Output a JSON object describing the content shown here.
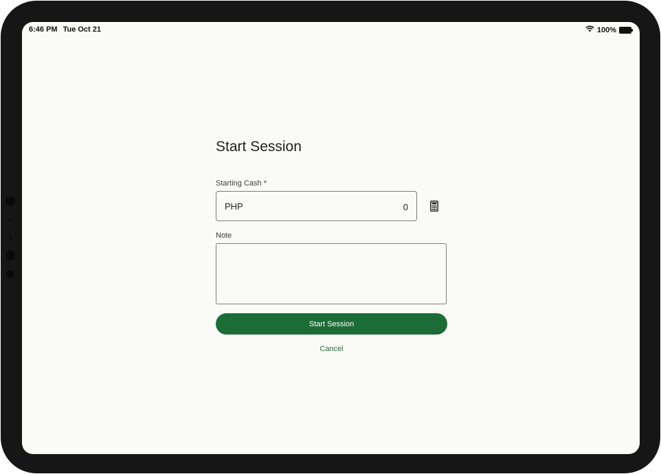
{
  "status_bar": {
    "time": "6:46 PM",
    "date": "Tue Oct 21",
    "battery": "100%",
    "icons": [
      "wifi-icon",
      "battery-icon"
    ]
  },
  "form": {
    "title": "Start Session",
    "starting_cash": {
      "label": "Starting Cash *",
      "currency": "PHP",
      "value": "0",
      "calculator_icon": "calculator-icon"
    },
    "note": {
      "label": "Note",
      "value": ""
    },
    "primary_button": "Start Session",
    "cancel_label": "Cancel"
  },
  "colors": {
    "accent": "#1c6c36",
    "background": "#fafbf6",
    "link": "#2e6a3f"
  }
}
